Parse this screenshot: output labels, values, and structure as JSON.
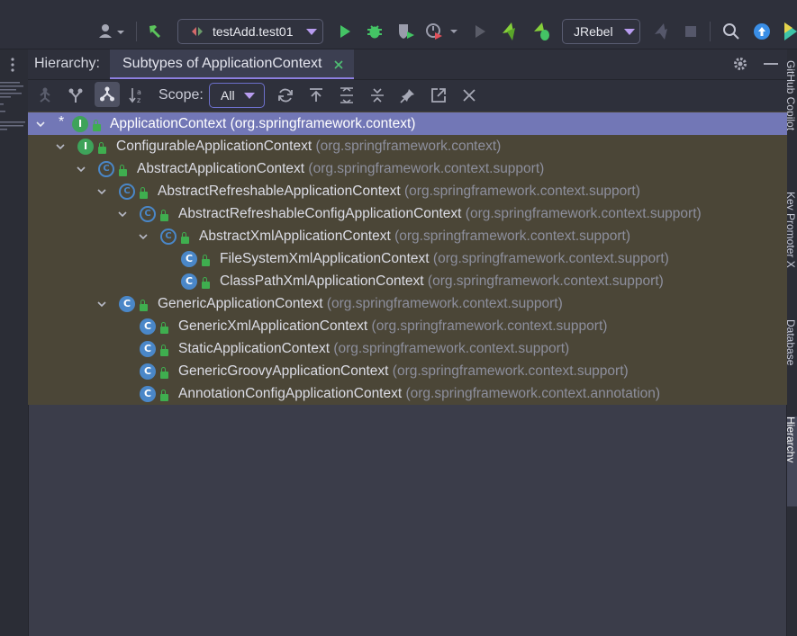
{
  "toolbar": {
    "run_config": "testAdd.test01",
    "jrebel": "JRebel"
  },
  "panel": {
    "title": "Hierarchy:",
    "tab": "Subtypes of ApplicationContext",
    "scope_label": "Scope:",
    "scope_value": "All"
  },
  "side_tabs": {
    "copilot": "GitHub Copilot",
    "key_promoter": "Key Promoter X",
    "database": "Database",
    "hierarchy": "Hierarchy"
  },
  "tree": [
    {
      "name": "ApplicationContext",
      "pkg": "(org.springframework.context)",
      "kind": "interface",
      "selected": true
    },
    {
      "name": "ConfigurableApplicationContext",
      "pkg": "(org.springframework.context)",
      "kind": "interface"
    },
    {
      "name": "AbstractApplicationContext",
      "pkg": "(org.springframework.context.support)",
      "kind": "abstract"
    },
    {
      "name": "AbstractRefreshableApplicationContext",
      "pkg": "(org.springframework.context.support)",
      "kind": "abstract"
    },
    {
      "name": "AbstractRefreshableConfigApplicationContext",
      "pkg": "(org.springframework.context.support)",
      "kind": "abstract"
    },
    {
      "name": "AbstractXmlApplicationContext",
      "pkg": "(org.springframework.context.support)",
      "kind": "abstract"
    },
    {
      "name": "FileSystemXmlApplicationContext",
      "pkg": "(org.springframework.context.support)",
      "kind": "class"
    },
    {
      "name": "ClassPathXmlApplicationContext",
      "pkg": "(org.springframework.context.support)",
      "kind": "class"
    },
    {
      "name": "GenericApplicationContext",
      "pkg": "(org.springframework.context.support)",
      "kind": "class"
    },
    {
      "name": "GenericXmlApplicationContext",
      "pkg": "(org.springframework.context.support)",
      "kind": "class"
    },
    {
      "name": "StaticApplicationContext",
      "pkg": "(org.springframework.context.support)",
      "kind": "class"
    },
    {
      "name": "GenericGroovyApplicationContext",
      "pkg": "(org.springframework.context.support)",
      "kind": "class"
    },
    {
      "name": "AnnotationConfigApplicationContext",
      "pkg": "(org.springframework.context.annotation)",
      "kind": "class"
    }
  ]
}
